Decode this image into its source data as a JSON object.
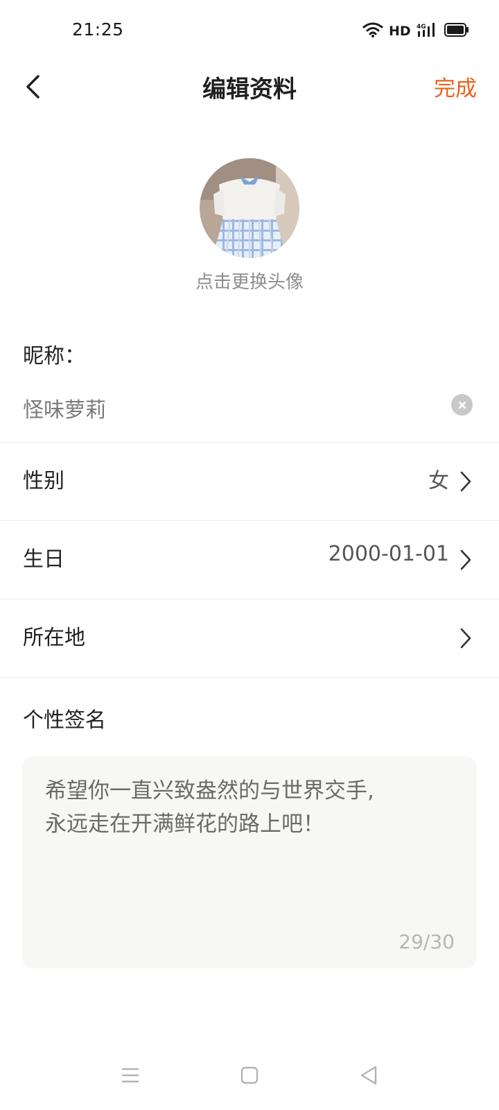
{
  "status_bar": {
    "time": "21:25",
    "network_label": "HD",
    "icons": [
      "wifi-icon",
      "signal-4g-icon",
      "battery-icon"
    ]
  },
  "nav": {
    "title": "编辑资料",
    "done_label": "完成",
    "back_icon": "chevron-left-icon"
  },
  "avatar": {
    "hint": "点击更换头像"
  },
  "nickname": {
    "label": "昵称：",
    "value": "怪味萝莉"
  },
  "rows": [
    {
      "label": "性别",
      "value": "女"
    },
    {
      "label": "生日",
      "value": "2000-01-01"
    },
    {
      "label": "所在地",
      "value": ""
    }
  ],
  "signature": {
    "label": "个性签名",
    "text": "希望你一直兴致盎然的与世界交手,\n永远走在开满鲜花的路上吧！",
    "count": "29/30"
  },
  "colors": {
    "accent": "#e8631c",
    "background": "#ffffff",
    "textarea_bg": "#f7f7f5",
    "divider": "#ececec"
  }
}
